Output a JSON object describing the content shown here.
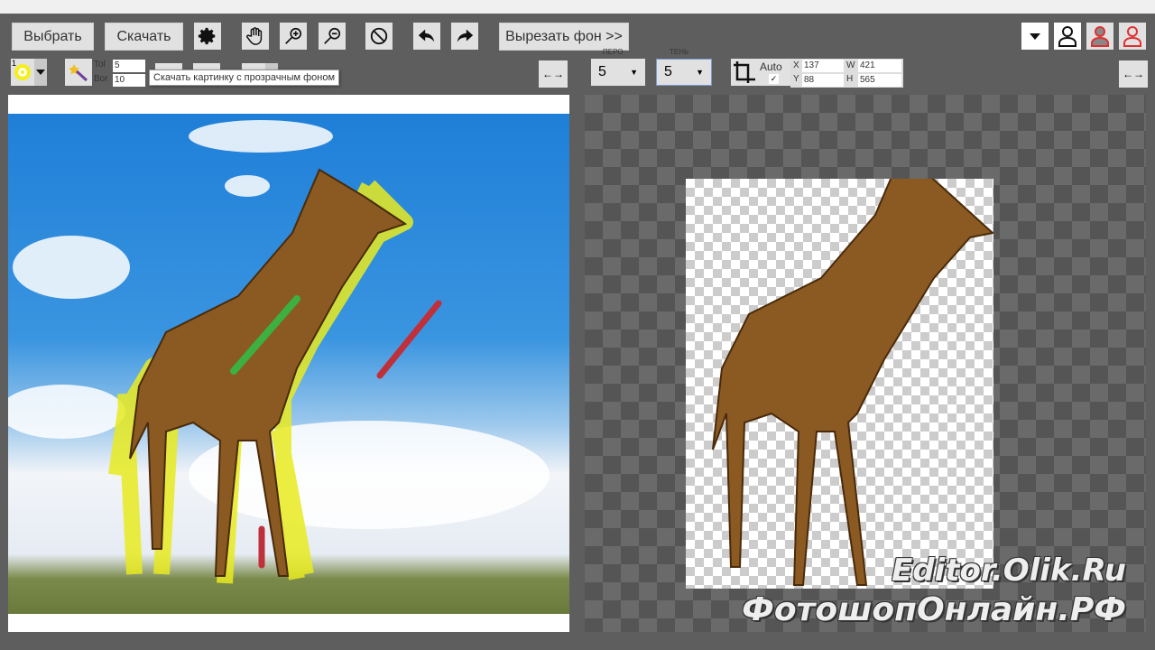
{
  "toolbar": {
    "select_label": "Выбрать",
    "download_label": "Скачать",
    "cut_bg_label": "Вырезать фон >>",
    "download_tooltip": "Скачать картинку с прозрачным фоном"
  },
  "tools": {
    "brush_number": "1",
    "tol_label": "Tol",
    "tol_value": "5",
    "bor_label": "Bor",
    "bor_value": "10",
    "pen_label": "ПЕРО",
    "pen_value": "5",
    "shadow_label": "ТЕНЬ",
    "shadow_value": "5",
    "auto_label": "Auto",
    "crop": {
      "x_label": "X",
      "x": "137",
      "y_label": "Y",
      "y": "88",
      "w_label": "W",
      "w": "421",
      "h_label": "H",
      "h": "565"
    }
  },
  "colors": {
    "brush_yellow": "#f5ef1a",
    "keep_green": "#22b14c",
    "remove_red": "#e02020",
    "user_red": "#e03030"
  },
  "watermark": {
    "line1": "Editor.Olik.Ru",
    "line2": "ФотошопОнлайн.РФ"
  }
}
